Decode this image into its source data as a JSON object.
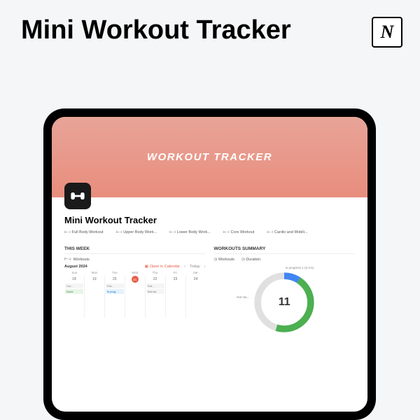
{
  "header": {
    "title": "Mini Workout Tracker",
    "logo": "N"
  },
  "app": {
    "banner_title": "WORKOUT TRACKER",
    "page_title": "Mini Workout Tracker"
  },
  "categories": [
    {
      "label": "Full Body Workout"
    },
    {
      "label": "Upper Body Work..."
    },
    {
      "label": "Lower Body Work..."
    },
    {
      "label": "Core Workout"
    },
    {
      "label": "Cardio and Mobili..."
    }
  ],
  "sections": {
    "left": {
      "title": "THIS WEEK",
      "subtitle": "Workouts",
      "month": "August 2024",
      "open_cal": "Open in Calendar",
      "today": "Today",
      "days": [
        "Sun",
        "Mon",
        "Tue",
        "Wed",
        "Thu",
        "Fri",
        "Sat"
      ],
      "dates": [
        "18",
        "19",
        "20",
        "21",
        "22",
        "23",
        "24"
      ],
      "today_index": 3,
      "events": {
        "0": [
          {
            "text": "Cor...",
            "cls": "ev-na"
          },
          {
            "text": "Done",
            "cls": "ev-done"
          }
        ],
        "2": [
          {
            "text": "Full...",
            "cls": "ev-na"
          },
          {
            "text": "In prog",
            "cls": "ev-prog"
          }
        ],
        "4": [
          {
            "text": "Full...",
            "cls": "ev-na"
          },
          {
            "text": "Not sta",
            "cls": "ev-na"
          }
        ]
      }
    },
    "right": {
      "title": "WORKOUTS SUMMARY",
      "tabs": [
        "Workouts",
        "Duration"
      ],
      "in_progress": "In progress  1 (9.1%)",
      "not_sta": "Not sta...",
      "center": "11"
    }
  },
  "chart_data": {
    "type": "pie",
    "title": "Workouts Summary",
    "series": [
      {
        "name": "In progress",
        "value": 1,
        "percent": 9.1,
        "color": "#4285f4"
      },
      {
        "name": "Done",
        "value": 5,
        "percent": 45.5,
        "color": "#4caf50"
      },
      {
        "name": "Not started",
        "value": 5,
        "percent": 45.5,
        "color": "#e0e0e0"
      }
    ],
    "total": 11
  }
}
